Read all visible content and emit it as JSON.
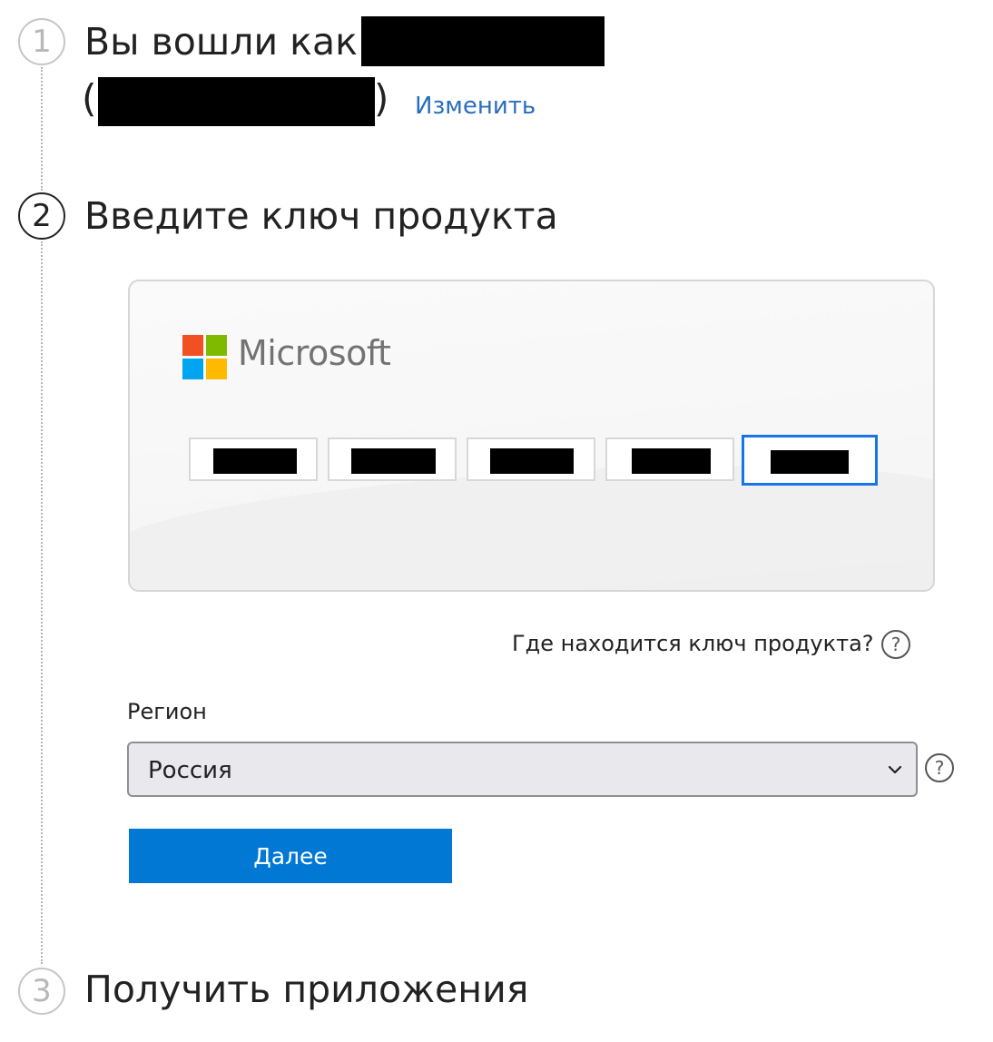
{
  "steps": [
    {
      "number": "1",
      "state": "inactive",
      "title": "Вы вошли как"
    },
    {
      "number": "2",
      "state": "active",
      "title": "Введите ключ продукта"
    },
    {
      "number": "3",
      "state": "inactive",
      "title": "Получить приложения"
    }
  ],
  "account": {
    "paren_open": "(",
    "paren_close": ")",
    "change_label": "Изменить"
  },
  "product_key": {
    "brand": "Microsoft",
    "segment_count": 5,
    "focused_segment": 5
  },
  "help": {
    "where_key_text": "Где находится ключ продукта?",
    "icon_glyph": "?"
  },
  "region": {
    "label": "Регион",
    "selected": "Россия"
  },
  "buttons": {
    "next_label": "Далее"
  },
  "colors": {
    "accent": "#0078d4",
    "link": "#2a6ebb",
    "focus": "#1a73e8",
    "ms_red": "#f25022",
    "ms_green": "#7fba00",
    "ms_blue": "#00a4ef",
    "ms_yellow": "#ffb900"
  },
  "icons": {
    "select": "chevron-down-icon",
    "help": "question-circle-icon"
  }
}
